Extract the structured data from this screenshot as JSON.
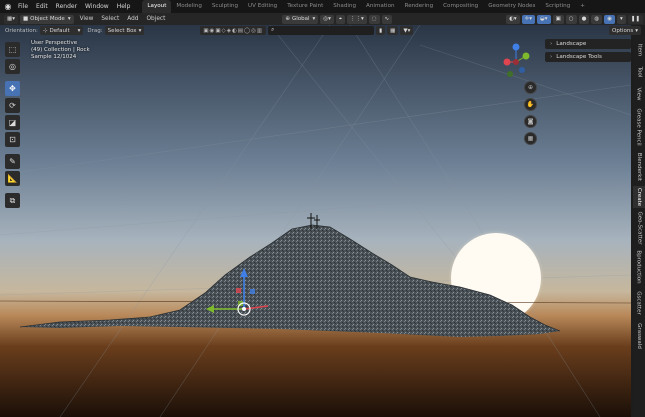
{
  "topbar": {
    "menus": [
      "File",
      "Edit",
      "Render",
      "Window",
      "Help"
    ],
    "workspaces": [
      "Layout",
      "Modeling",
      "Sculpting",
      "UV Editing",
      "Texture Paint",
      "Shading",
      "Animation",
      "Rendering",
      "Compositing",
      "Geometry Nodes",
      "Scripting"
    ],
    "active_workspace": "Layout",
    "add_tab": "+"
  },
  "header": {
    "mode": "Object Mode",
    "menus": [
      "View",
      "Select",
      "Add",
      "Object"
    ],
    "transform_orientation": "Global"
  },
  "row2": {
    "orientation_label": "Orientation:",
    "orientation_value": "Default",
    "drag_label": "Drag:",
    "drag_value": "Select Box",
    "options": "Options"
  },
  "overlay": {
    "perspective": "User Perspective",
    "collection": "(49) Collection | Rock",
    "sample": "Sample 12/1024"
  },
  "panels": [
    "Landscape",
    "Landscape Tools"
  ],
  "sidetabs": [
    "Item",
    "Tool",
    "View",
    "Grease Pencil",
    "Blenderkit",
    "Create",
    "Geo-Scatter",
    "Bproduction",
    "Gscatter",
    "Graswald"
  ],
  "active_sidetab": "Create",
  "gizmo": {
    "x": "X",
    "y": "Y",
    "z": "Z"
  },
  "colors": {
    "accent": "#4772b3",
    "x_axis": "#e0454f",
    "y_axis": "#7dba2c",
    "z_axis": "#3f7fe6"
  }
}
